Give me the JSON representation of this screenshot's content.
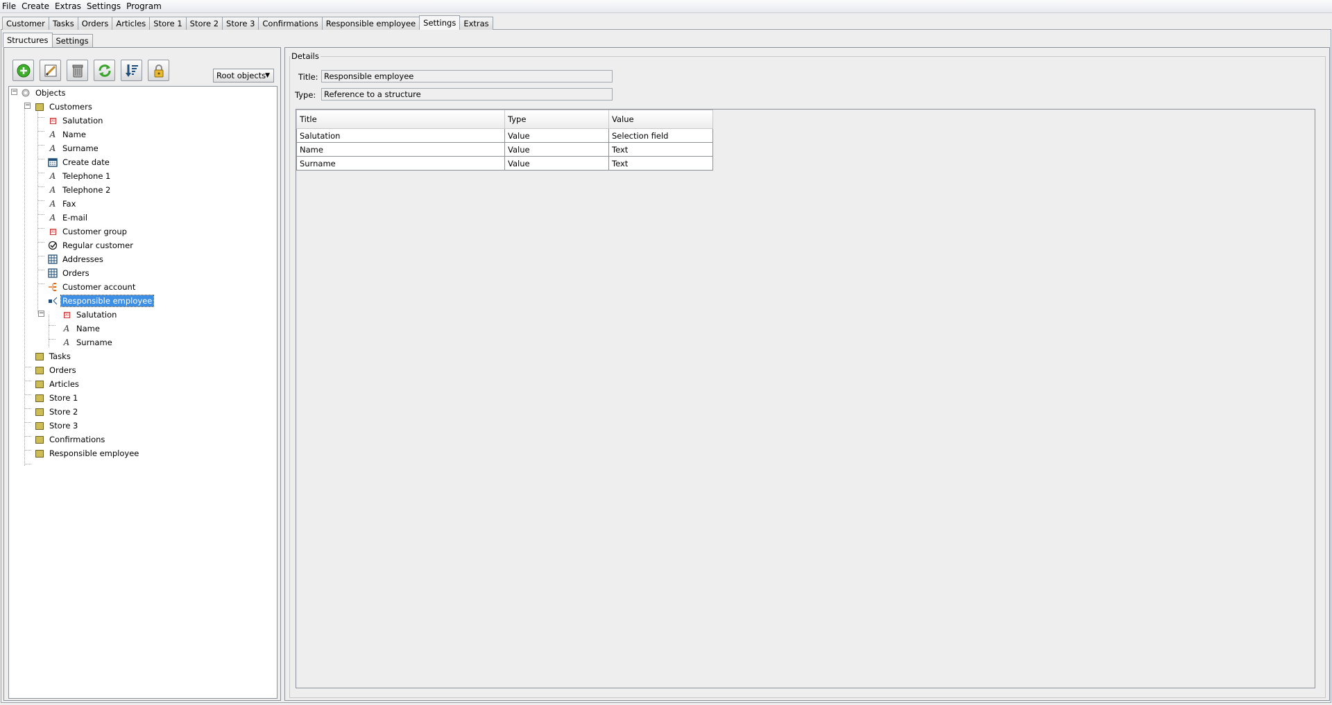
{
  "menu": [
    "File",
    "Create",
    "Extras",
    "Settings",
    "Program"
  ],
  "top_tabs": [
    {
      "label": "Customer"
    },
    {
      "label": "Tasks"
    },
    {
      "label": "Orders"
    },
    {
      "label": "Articles"
    },
    {
      "label": "Store 1"
    },
    {
      "label": "Store 2"
    },
    {
      "label": "Store 3"
    },
    {
      "label": "Confirmations"
    },
    {
      "label": "Responsible employee"
    },
    {
      "label": "Settings",
      "active": true
    },
    {
      "label": "Extras"
    }
  ],
  "sub_tabs": [
    {
      "label": "Structures",
      "active": true
    },
    {
      "label": "Settings"
    }
  ],
  "toolbar": {
    "buttons": [
      "add-icon",
      "edit-icon",
      "delete-icon",
      "refresh-icon",
      "sort-icon",
      "lock-icon"
    ],
    "root_select": "Root objects"
  },
  "tree": {
    "root": "Objects",
    "customers": {
      "label": "Customers",
      "children": [
        {
          "label": "Salutation",
          "icon": "selection-field-icon"
        },
        {
          "label": "Name",
          "icon": "text-field-icon"
        },
        {
          "label": "Surname",
          "icon": "text-field-icon"
        },
        {
          "label": "Create date",
          "icon": "calendar-icon"
        },
        {
          "label": "Telephone 1",
          "icon": "text-field-icon"
        },
        {
          "label": "Telephone 2",
          "icon": "text-field-icon"
        },
        {
          "label": "Fax",
          "icon": "text-field-icon"
        },
        {
          "label": "E-mail",
          "icon": "text-field-icon"
        },
        {
          "label": "Customer group",
          "icon": "selection-field-icon"
        },
        {
          "label": "Regular customer",
          "icon": "checkbox-icon"
        },
        {
          "label": "Addresses",
          "icon": "table-icon"
        },
        {
          "label": "Orders",
          "icon": "table-icon"
        },
        {
          "label": "Customer account",
          "icon": "account-icon"
        }
      ],
      "responsible": {
        "label": "Responsible employee",
        "children": [
          {
            "label": "Salutation",
            "icon": "selection-field-icon"
          },
          {
            "label": "Name",
            "icon": "text-field-icon"
          },
          {
            "label": "Surname",
            "icon": "text-field-icon"
          }
        ]
      }
    },
    "others": [
      "Tasks",
      "Orders",
      "Articles",
      "Store 1",
      "Store 2",
      "Store 3",
      "Confirmations",
      "Responsible employee"
    ]
  },
  "details": {
    "group_title": "Details",
    "title_label": "Title:",
    "title_value": "Responsible employee",
    "type_label": "Type:",
    "type_value": "Reference to a structure",
    "table": {
      "headers": [
        "Title",
        "Type",
        "Value"
      ],
      "rows": [
        [
          "Salutation",
          "Value",
          "Selection field"
        ],
        [
          "Name",
          "Value",
          "Text"
        ],
        [
          "Surname",
          "Value",
          "Text"
        ]
      ]
    }
  }
}
